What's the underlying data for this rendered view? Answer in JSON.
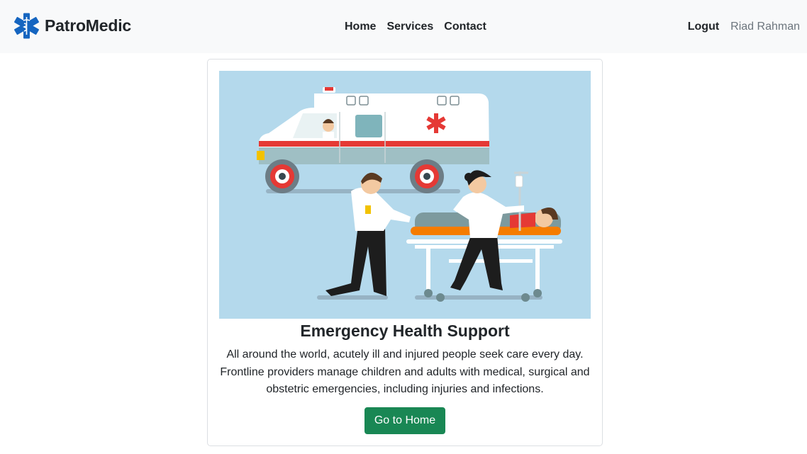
{
  "navbar": {
    "brand": {
      "name": "PatroMedic",
      "logo_icon": "star-of-life-icon",
      "logo_color": "#1565c0"
    },
    "links": [
      {
        "label": "Home"
      },
      {
        "label": "Services"
      },
      {
        "label": "Contact"
      }
    ],
    "logout_label": "Logut",
    "user_name": "Riad Rahman"
  },
  "card": {
    "image_icon": "ambulance-paramedics-illustration",
    "title": "Emergency Health Support",
    "text": "All around the world, acutely ill and injured people seek care every day. Frontline providers manage children and adults with medical, surgical and obstetric emergencies, including injuries and infections.",
    "button_label": "Go to Home",
    "button_color": "#198754",
    "image_background": "#b4d9ec"
  }
}
